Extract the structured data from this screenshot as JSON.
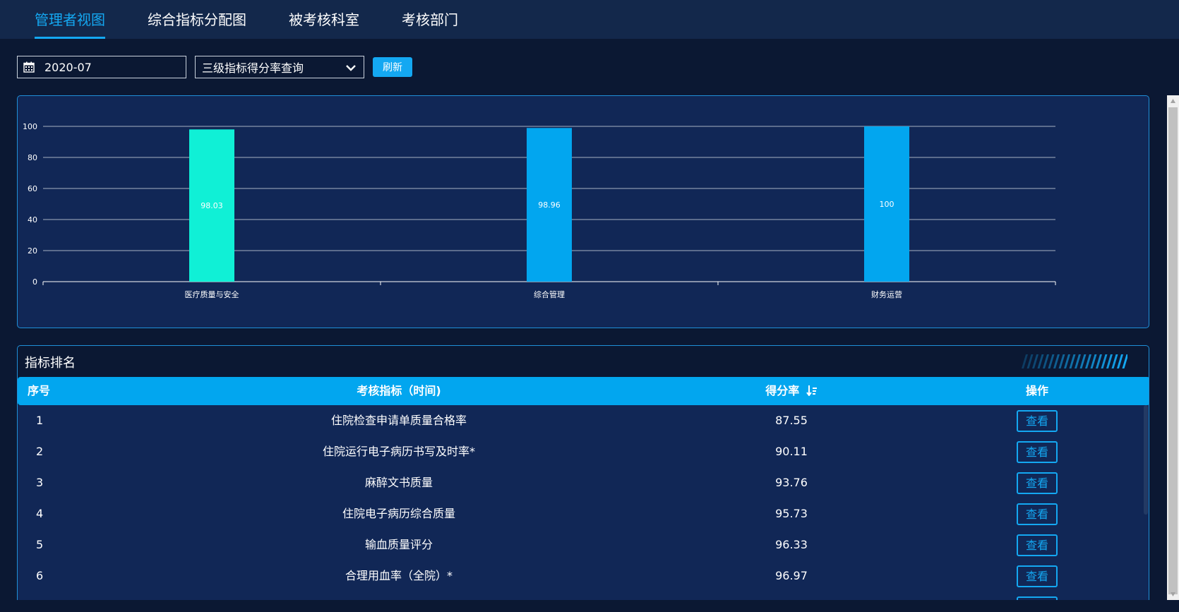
{
  "nav": {
    "tabs": [
      {
        "label": "管理者视图",
        "active": true
      },
      {
        "label": "综合指标分配图",
        "active": false
      },
      {
        "label": "被考核科室",
        "active": false
      },
      {
        "label": "考核部门",
        "active": false
      }
    ]
  },
  "toolbar": {
    "date_value": "2020-07",
    "calendar_icon": "calendar-icon",
    "select_value": "三级指标得分率查询",
    "refresh_label": "刷新"
  },
  "colors": {
    "accent": "#14a8f2",
    "bar_highlight": "#10f0d6",
    "bar_default": "#02a6ef",
    "panel_bg": "#112756",
    "page_bg": "#0b1833"
  },
  "chart_data": {
    "type": "bar",
    "categories": [
      "医疗质量与安全",
      "综合管理",
      "财务运营"
    ],
    "values": [
      98.03,
      98.96,
      100
    ],
    "data_labels": [
      "98.03",
      "98.96",
      "100"
    ],
    "ylim": [
      0,
      100
    ],
    "yticks": [
      0,
      20,
      40,
      60,
      80,
      100
    ],
    "grid": true,
    "xlabel": "",
    "ylabel": ""
  },
  "ranking": {
    "title": "指标排名",
    "headers": {
      "index": "序号",
      "name": "考核指标（时间)",
      "score": "得分率",
      "action": "操作"
    },
    "sort_icon": "sort-descending-icon",
    "rows": [
      {
        "index": "1",
        "name": "住院检查申请单质量合格率",
        "score": "87.55",
        "action": "查看"
      },
      {
        "index": "2",
        "name": "住院运行电子病历书写及时率*",
        "score": "90.11",
        "action": "查看"
      },
      {
        "index": "3",
        "name": "麻醉文书质量",
        "score": "93.76",
        "action": "查看"
      },
      {
        "index": "4",
        "name": "住院电子病历综合质量",
        "score": "95.73",
        "action": "查看"
      },
      {
        "index": "5",
        "name": "输血质量评分",
        "score": "96.33",
        "action": "查看"
      },
      {
        "index": "6",
        "name": "合理用血率（全院）*",
        "score": "96.97",
        "action": "查看"
      }
    ]
  }
}
